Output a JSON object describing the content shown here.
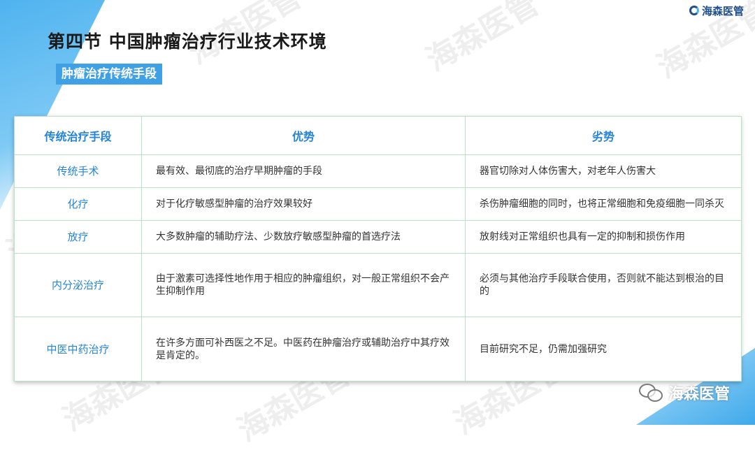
{
  "header": {
    "title": "第四节 中国肿瘤治疗行业技术环境",
    "subtitle": "肿瘤治疗传统手段",
    "logo_text": "海森医管"
  },
  "watermark_text": "海森医管",
  "table": {
    "columns": [
      "传统治疗手段",
      "优势",
      "劣势"
    ],
    "rows": [
      {
        "name": "传统手术",
        "pro": "最有效、最彻底的治疗早期肿瘤的手段",
        "con": "器官切除对人体伤害大，对老年人伤害大"
      },
      {
        "name": "化疗",
        "pro": "对于化疗敏感型肿瘤的治疗效果较好",
        "con": "杀伤肿瘤细胞的同时，也将正常细胞和免疫细胞一同杀灭"
      },
      {
        "name": "放疗",
        "pro": "大多数肿瘤的辅助疗法、少数放疗敏感型肿瘤的首选疗法",
        "con": "放射线对正常组织也具有一定的抑制和损伤作用"
      },
      {
        "name": "内分泌治疗",
        "pro": "由于激素可选择性地作用于相应的肿瘤组织，对一般正常组织不会产生抑制作用",
        "con": "必须与其他治疗手段联合使用，否则就不能达到根治的目的"
      },
      {
        "name": "中医中药治疗",
        "pro": "在许多方面可补西医之不足。中医药在肿瘤治疗或辅助治疗中其疗效是肯定的。",
        "con": "目前研究不足，仍需加强研究"
      }
    ]
  },
  "footer": {
    "brand": "海森医管",
    "icon": "wechat-icon"
  },
  "colors": {
    "accent": "#3fa0e6",
    "header_text": "#2384d8",
    "border": "#b9e2c6"
  }
}
